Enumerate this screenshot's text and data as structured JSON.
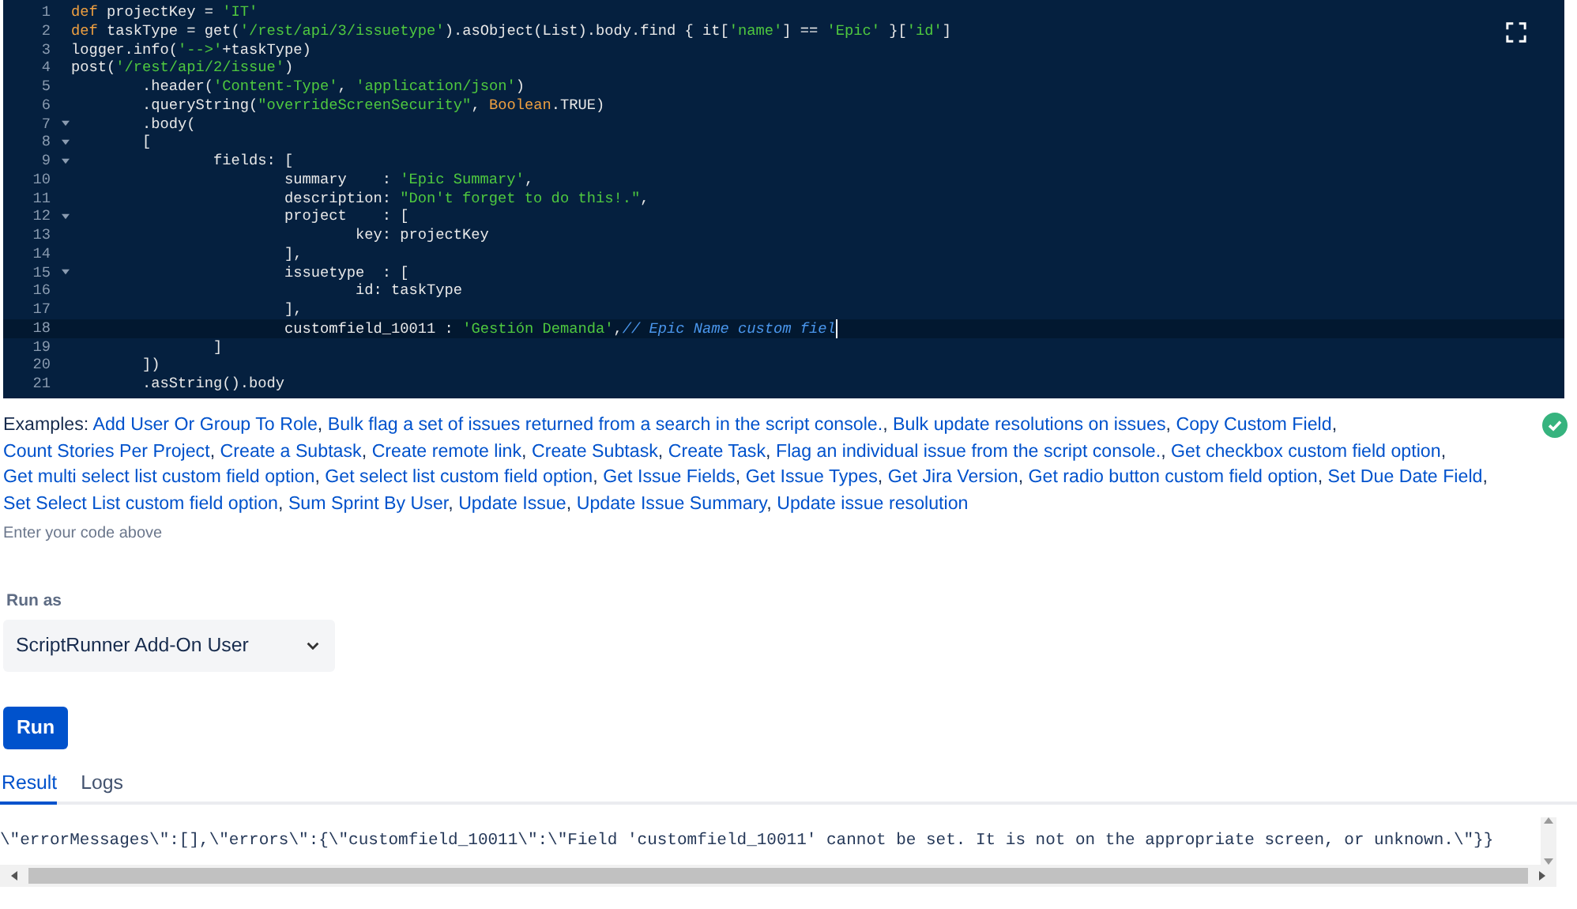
{
  "editor": {
    "lines": [
      {
        "number": "1",
        "fold": false,
        "active": false,
        "tokens": [
          {
            "kind": "kw",
            "text": "def"
          },
          {
            "kind": "plain",
            "text": " projectKey = "
          },
          {
            "kind": "str",
            "text": "'IT'"
          }
        ]
      },
      {
        "number": "2",
        "fold": false,
        "active": false,
        "tokens": [
          {
            "kind": "kw",
            "text": "def"
          },
          {
            "kind": "plain",
            "text": " taskType = get("
          },
          {
            "kind": "str",
            "text": "'/rest/api/3/issuetype'"
          },
          {
            "kind": "plain",
            "text": ").asObject(List).body.find { it["
          },
          {
            "kind": "str",
            "text": "'name'"
          },
          {
            "kind": "plain",
            "text": "] == "
          },
          {
            "kind": "str",
            "text": "'Epic'"
          },
          {
            "kind": "plain",
            "text": " }["
          },
          {
            "kind": "str",
            "text": "'id'"
          },
          {
            "kind": "plain",
            "text": "]"
          }
        ]
      },
      {
        "number": "3",
        "fold": false,
        "active": false,
        "tokens": [
          {
            "kind": "plain",
            "text": "logger.info("
          },
          {
            "kind": "str",
            "text": "'-->'"
          },
          {
            "kind": "plain",
            "text": "+taskType)"
          }
        ]
      },
      {
        "number": "4",
        "fold": false,
        "active": false,
        "tokens": [
          {
            "kind": "plain",
            "text": "post("
          },
          {
            "kind": "str",
            "text": "'/rest/api/2/issue'"
          },
          {
            "kind": "plain",
            "text": ")"
          }
        ]
      },
      {
        "number": "5",
        "fold": false,
        "active": false,
        "tokens": [
          {
            "kind": "plain",
            "text": "\t.header("
          },
          {
            "kind": "str",
            "text": "'Content-Type'"
          },
          {
            "kind": "plain",
            "text": ", "
          },
          {
            "kind": "str",
            "text": "'application/json'"
          },
          {
            "kind": "plain",
            "text": ")"
          }
        ]
      },
      {
        "number": "6",
        "fold": false,
        "active": false,
        "tokens": [
          {
            "kind": "plain",
            "text": "\t.queryString("
          },
          {
            "kind": "str",
            "text": "\"overrideScreenSecurity\""
          },
          {
            "kind": "plain",
            "text": ", "
          },
          {
            "kind": "kw",
            "text": "Boolean"
          },
          {
            "kind": "plain",
            "text": ".TRUE)"
          }
        ]
      },
      {
        "number": "7",
        "fold": true,
        "active": false,
        "tokens": [
          {
            "kind": "plain",
            "text": "\t.body("
          }
        ]
      },
      {
        "number": "8",
        "fold": true,
        "active": false,
        "tokens": [
          {
            "kind": "plain",
            "text": "\t["
          }
        ]
      },
      {
        "number": "9",
        "fold": true,
        "active": false,
        "tokens": [
          {
            "kind": "plain",
            "text": "\t\tfields: ["
          }
        ]
      },
      {
        "number": "10",
        "fold": false,
        "active": false,
        "tokens": [
          {
            "kind": "plain",
            "text": "\t\t\tsummary    : "
          },
          {
            "kind": "str",
            "text": "'Epic Summary'"
          },
          {
            "kind": "plain",
            "text": ","
          }
        ]
      },
      {
        "number": "11",
        "fold": false,
        "active": false,
        "tokens": [
          {
            "kind": "plain",
            "text": "\t\t\tdescription: "
          },
          {
            "kind": "str",
            "text": "\"Don't forget to do this!.\""
          },
          {
            "kind": "plain",
            "text": ","
          }
        ]
      },
      {
        "number": "12",
        "fold": true,
        "active": false,
        "tokens": [
          {
            "kind": "plain",
            "text": "\t\t\tproject    : ["
          }
        ]
      },
      {
        "number": "13",
        "fold": false,
        "active": false,
        "tokens": [
          {
            "kind": "plain",
            "text": "\t\t\t\tkey: projectKey"
          }
        ]
      },
      {
        "number": "14",
        "fold": false,
        "active": false,
        "tokens": [
          {
            "kind": "plain",
            "text": "\t\t\t],"
          }
        ]
      },
      {
        "number": "15",
        "fold": true,
        "active": false,
        "tokens": [
          {
            "kind": "plain",
            "text": "\t\t\tissuetype  : ["
          }
        ]
      },
      {
        "number": "16",
        "fold": false,
        "active": false,
        "tokens": [
          {
            "kind": "plain",
            "text": "\t\t\t\tid: taskType"
          }
        ]
      },
      {
        "number": "17",
        "fold": false,
        "active": false,
        "tokens": [
          {
            "kind": "plain",
            "text": "\t\t\t],"
          }
        ]
      },
      {
        "number": "18",
        "fold": false,
        "active": true,
        "tokens": [
          {
            "kind": "plain",
            "text": "\t\t\tcustomfield_10011 : "
          },
          {
            "kind": "str",
            "text": "'Gestión Demanda'"
          },
          {
            "kind": "plain",
            "text": ","
          },
          {
            "kind": "comment",
            "text": "// Epic Name custom fiel"
          }
        ]
      },
      {
        "number": "19",
        "fold": false,
        "active": false,
        "tokens": [
          {
            "kind": "plain",
            "text": "\t\t]"
          }
        ]
      },
      {
        "number": "20",
        "fold": false,
        "active": false,
        "tokens": [
          {
            "kind": "plain",
            "text": "\t])"
          }
        ]
      },
      {
        "number": "21",
        "fold": false,
        "active": false,
        "tokens": [
          {
            "kind": "plain",
            "text": "\t.asString().body"
          }
        ]
      }
    ]
  },
  "examples": {
    "label": "Examples:",
    "links": [
      "Add User Or Group To Role",
      "Bulk flag a set of issues returned from a search in the script console.",
      "Bulk update resolutions on issues",
      "Copy Custom Field",
      "Count Stories Per Project",
      "Create a Subtask",
      "Create remote link",
      "Create Subtask",
      "Create Task",
      "Flag an individual issue from the script console.",
      "Get checkbox custom field option",
      "Get multi select list custom field option",
      "Get select list custom field option",
      "Get Issue Fields",
      "Get Issue Types",
      "Get Jira Version",
      "Get radio button custom field option",
      "Set Due Date Field",
      "Set Select List custom field option",
      "Sum Sprint By User",
      "Update Issue",
      "Update Issue Summary",
      "Update issue resolution"
    ],
    "separator": ", ",
    "valid": true
  },
  "hint": "Enter your code above",
  "run_as": {
    "label": "Run as",
    "value": "ScriptRunner Add-On User"
  },
  "run_button": "Run",
  "tabs": [
    {
      "label": "Result",
      "selected": true
    },
    {
      "label": "Logs",
      "selected": false
    }
  ],
  "output": "\\\"errorMessages\\\":[],\\\"errors\\\":{\\\"customfield_10011\\\":\\\"Field 'customfield_10011' cannot be set. It is not on the appropriate screen, or unknown.\\\"}}"
}
